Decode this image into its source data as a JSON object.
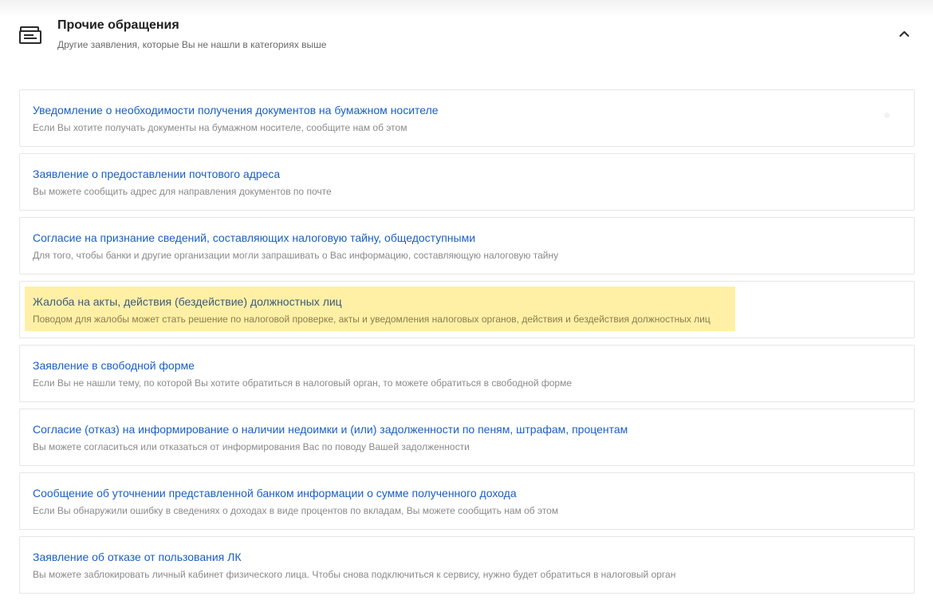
{
  "section": {
    "icon": "document-stack-icon",
    "title": "Прочие обращения",
    "subtitle": "Другие заявления, которые Вы не нашли в категориях выше",
    "toggle_icon": "chevron-up-icon",
    "expanded": true
  },
  "items": [
    {
      "title": "Уведомление о необходимости получения документов на бумажном носителе",
      "description": "Если Вы хотите получать документы на бумажном носителе, сообщите нам об этом",
      "highlighted": false
    },
    {
      "title": "Заявление о предоставлении почтового адреса",
      "description": "Вы можете сообщить адрес для направления документов по почте",
      "highlighted": false
    },
    {
      "title": "Согласие на признание сведений, составляющих налоговую тайну, общедоступными",
      "description": "Для того, чтобы банки и другие организации могли запрашивать о Вас информацию, составляющую налоговую тайну",
      "highlighted": false
    },
    {
      "title": "Жалоба на акты, действия (бездействие) должностных лиц",
      "description": "Поводом для жалобы может стать решение по налоговой проверке, акты и уведомления налоговых органов, действия и бездействия должностных лиц",
      "highlighted": true
    },
    {
      "title": "Заявление в свободной форме",
      "description": "Если Вы не нашли тему, по которой Вы хотите обратиться в налоговый орган, то можете обратиться в свободной форме",
      "highlighted": false
    },
    {
      "title": "Согласие (отказ) на информирование о наличии недоимки и (или) задолженности по пеням, штрафам, процентам",
      "description": "Вы можете согласиться или отказаться от информирования Вас по поводу Вашей задолженности",
      "highlighted": false
    },
    {
      "title": "Сообщение об уточнении представленной банком информации о сумме полученного дохода",
      "description": "Если Вы обнаружили ошибку в сведениях о доходах в виде процентов по вкладам, Вы можете сообщить нам об этом",
      "highlighted": false
    },
    {
      "title": "Заявление об отказе от пользования ЛК",
      "description": "Вы можете заблокировать личный кабинет физического лица. Чтобы снова подключиться к сервису, нужно будет обратиться в налоговый орган",
      "highlighted": false
    }
  ],
  "colors": {
    "link": "#1a5fc2",
    "description": "#8a8a8a",
    "highlight": "#fff0a6",
    "border": "#e6e6e6"
  }
}
